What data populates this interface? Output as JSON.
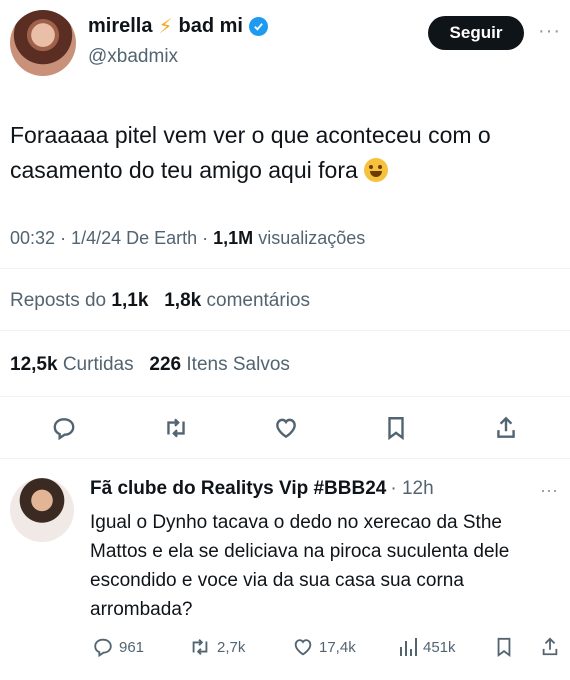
{
  "post": {
    "display_name": "mirella",
    "display_name_suffix": "bad mi",
    "handle": "@xbadmix",
    "follow_label": "Seguir",
    "more_label": "···",
    "text": "Foraaaaa pitel vem ver o que aconteceu com o casamento do teu amigo aqui fora",
    "time": "00:32",
    "date_source": "· 1/4/24 De Earth ·",
    "views_count": "1,1M",
    "views_label": "visualizações",
    "reposts_label": "Reposts do",
    "reposts_count": "1,1k",
    "comments_count": "1,8k",
    "comments_label": "comentários",
    "likes_count": "12,5k",
    "likes_label": "Curtidas",
    "saves_count": "226",
    "saves_label": "Itens Salvos"
  },
  "reply": {
    "name": "Fã clube do Realitys Vip #BBB24",
    "time": "· 12h",
    "more_label": "···",
    "text": "Igual o Dynho tacava o dedo no xerecao da Sthe Mattos e ela se deliciava na piroca suculenta dele escondido e voce via da sua casa sua corna arrombada?",
    "replies": "961",
    "reposts": "2,7k",
    "likes": "17,4k",
    "views": "451k"
  },
  "colors": {
    "text": "#0f1419",
    "secondary": "#536471",
    "verified": "#1d9bf0",
    "bolt": "#f5a623",
    "divider": "#eff3f4"
  }
}
